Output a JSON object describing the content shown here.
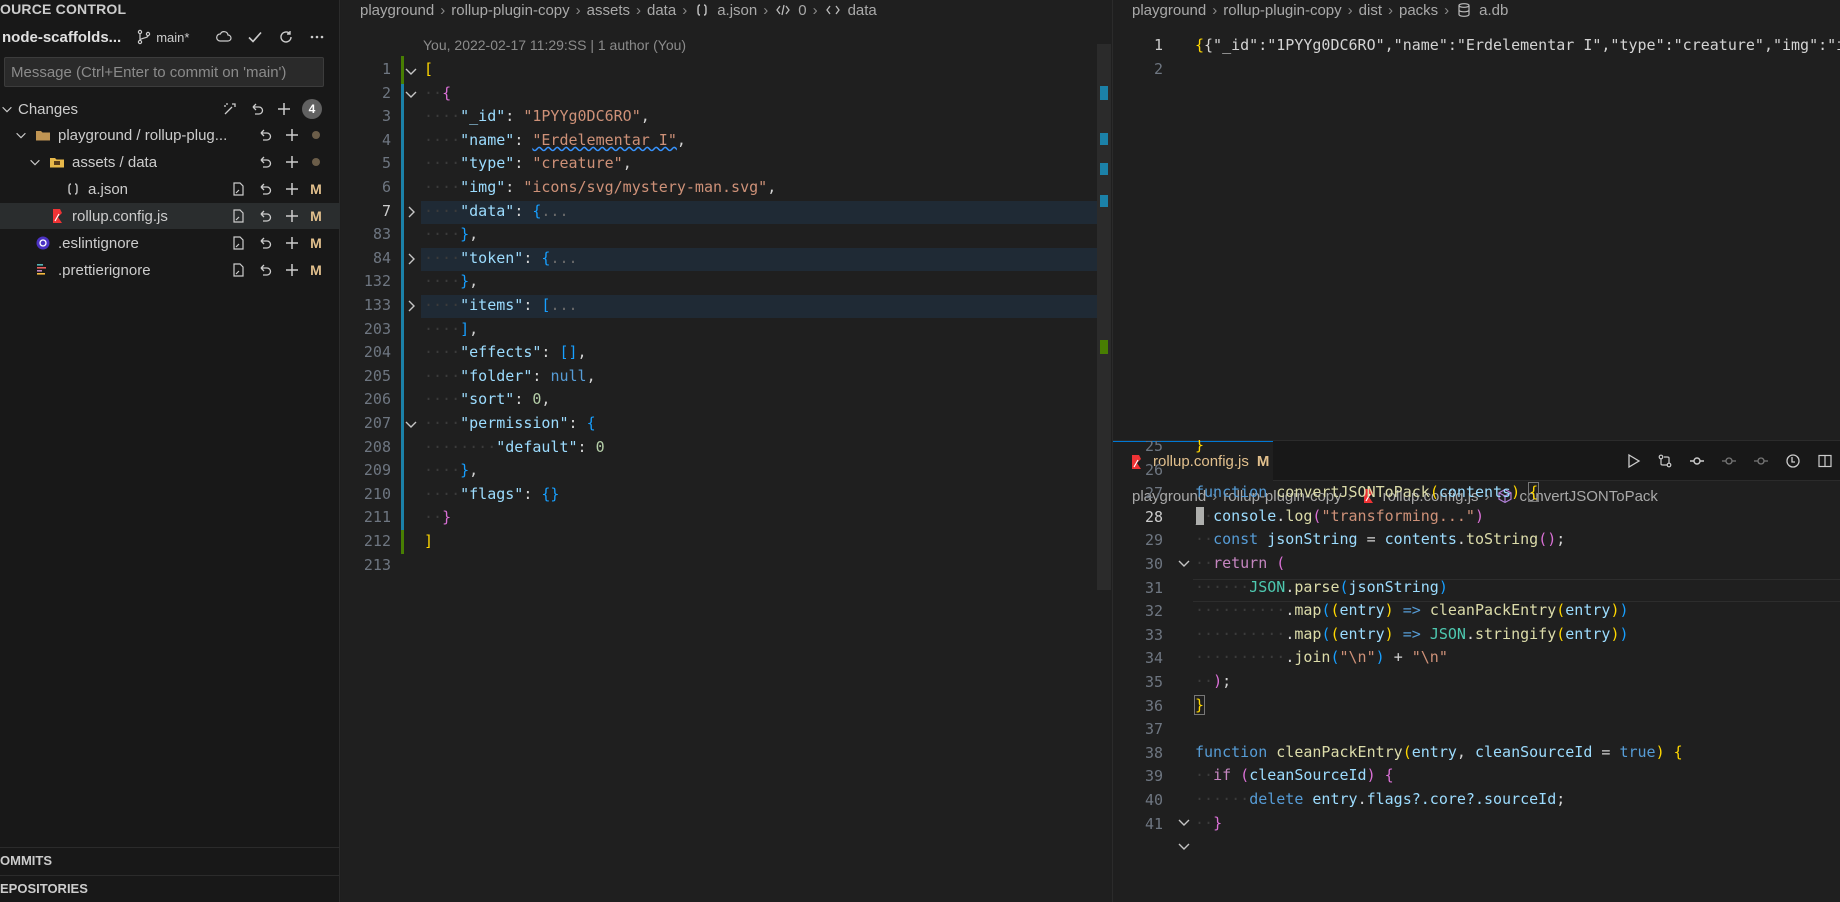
{
  "sidebar": {
    "title": "OURCE CONTROL",
    "repo": {
      "name": "node-scaffolds...",
      "branch": "main*"
    },
    "message_placeholder": "Message (Ctrl+Enter to commit on 'main')",
    "changes_label": "Changes",
    "changes_count": "4",
    "tree": [
      {
        "label": "playground / rollup-plug...",
        "status": ""
      },
      {
        "label": "assets / data",
        "status": ""
      },
      {
        "label": "a.json",
        "status": "M"
      },
      {
        "label": "rollup.config.js",
        "status": "M"
      },
      {
        "label": ".eslintignore",
        "status": "M"
      },
      {
        "label": ".prettierignore",
        "status": "M"
      }
    ],
    "sections": {
      "commits": "OMMITS",
      "repositories": "EPOSITORIES"
    }
  },
  "editor1": {
    "breadcrumb": [
      "playground",
      "rollup-plugin-copy",
      "assets",
      "data",
      "a.json",
      "0",
      "data"
    ],
    "blame": "You, 2022-02-17 11:29:SS | 1 author (You)",
    "line_numbers": [
      "1",
      "2",
      "3",
      "4",
      "5",
      "6",
      "7",
      "83",
      "84",
      "132",
      "133",
      "203",
      "204",
      "205",
      "206",
      "207",
      "208",
      "209",
      "210",
      "211",
      "212",
      "213"
    ],
    "json": {
      "id_key": "\"_id\"",
      "id_val": "\"1PYYg0DC6RO\"",
      "name_key": "\"name\"",
      "name_val": "\"Erdelementar I\"",
      "type_key": "\"type\"",
      "type_val": "\"creature\"",
      "img_key": "\"img\"",
      "img_val": "\"icons/svg/mystery-man.svg\"",
      "data_key": "\"data\"",
      "token_key": "\"token\"",
      "items_key": "\"items\"",
      "effects_key": "\"effects\"",
      "folder_key": "\"folder\"",
      "folder_val": "null",
      "sort_key": "\"sort\"",
      "sort_val": "0",
      "permission_key": "\"permission\"",
      "default_key": "\"default\"",
      "default_val": "0",
      "flags_key": "\"flags\"",
      "ellipsis": "..."
    }
  },
  "editor2": {
    "breadcrumb": [
      "playground",
      "rollup-plugin-copy",
      "dist",
      "packs",
      "a.db"
    ],
    "line_numbers": [
      "1",
      "2"
    ],
    "line1": "{\"_id\":\"1PYYg0DC6RO\",\"name\":\"Erdelementar I\",\"type\":\"creature\",\"img\":\"ic"
  },
  "editor3": {
    "tab": {
      "label": "rollup.config.js",
      "status": "M"
    },
    "breadcrumb": [
      "playground",
      "rollup-plugin-copy",
      "rollup.config.js",
      "convertJSONToPack"
    ],
    "line_numbers": [
      "25",
      "26",
      "27",
      "28",
      "29",
      "30",
      "31",
      "32",
      "33",
      "34",
      "35",
      "36",
      "37",
      "38",
      "39",
      "40",
      "41"
    ],
    "code": {
      "kw_function": "function",
      "fn_convert": "convertJSONToPack",
      "param_contents": "contents",
      "console": "console",
      "log": "log",
      "log_str": "\"transforming...\"",
      "kw_const": "const",
      "var_json": "jsonString",
      "to_string": "toString",
      "kw_return": "return",
      "json_obj": "JSON",
      "parse": "parse",
      "map": "map",
      "entry": "entry",
      "fn_clean": "cleanPackEntry",
      "stringify": "stringify",
      "join": "join",
      "nl_str": "\"\\n\"",
      "param_clean": "cleanSourceId",
      "kw_true": "true",
      "kw_if": "if",
      "kw_delete": "delete",
      "flags_chain": "flags?.core?.sourceId"
    }
  }
}
